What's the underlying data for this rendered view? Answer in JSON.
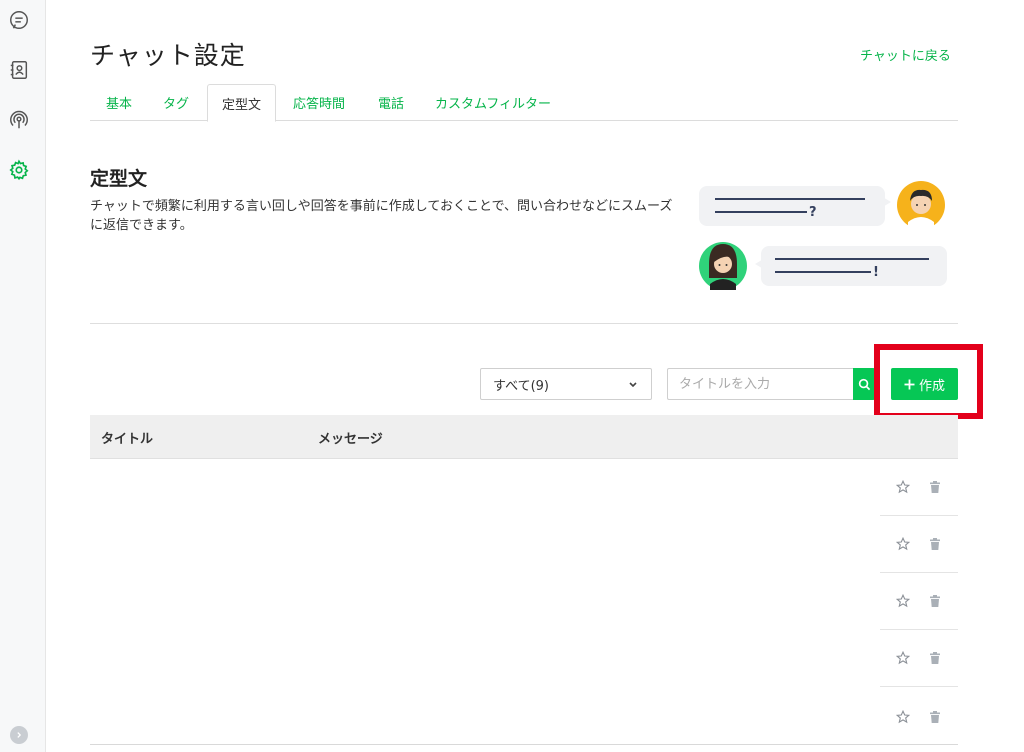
{
  "page": {
    "title": "チャット設定",
    "back_link": "チャットに戻る"
  },
  "sidebar": {
    "icons": [
      "chat-icon",
      "contacts-icon",
      "broadcast-icon",
      "settings-icon"
    ],
    "active": "settings-icon",
    "accent": "#06b44a"
  },
  "tabs": [
    {
      "label": "基本",
      "active": false
    },
    {
      "label": "タグ",
      "active": false
    },
    {
      "label": "定型文",
      "active": true
    },
    {
      "label": "応答時間",
      "active": false
    },
    {
      "label": "電話",
      "active": false
    },
    {
      "label": "カスタムフィルター",
      "active": false
    }
  ],
  "section": {
    "title": "定型文",
    "description": "チャットで頻繁に利用する言い回しや回答を事前に作成しておくことで、問い合わせなどにスムーズに返信できます。"
  },
  "illustration": {
    "bubble1_mark": "?",
    "bubble2_mark": "!"
  },
  "toolbar": {
    "filter_value": "すべて(9)",
    "search_placeholder": "タイトルを入力",
    "create_label": "作成"
  },
  "table": {
    "columns": [
      "タイトル",
      "メッセージ"
    ],
    "rows": [
      {
        "title": "",
        "message": ""
      },
      {
        "title": "",
        "message": ""
      },
      {
        "title": "",
        "message": ""
      },
      {
        "title": "",
        "message": ""
      },
      {
        "title": "",
        "message": ""
      }
    ]
  },
  "colors": {
    "brand_green": "#06c755",
    "highlight_red": "#e3001b"
  }
}
